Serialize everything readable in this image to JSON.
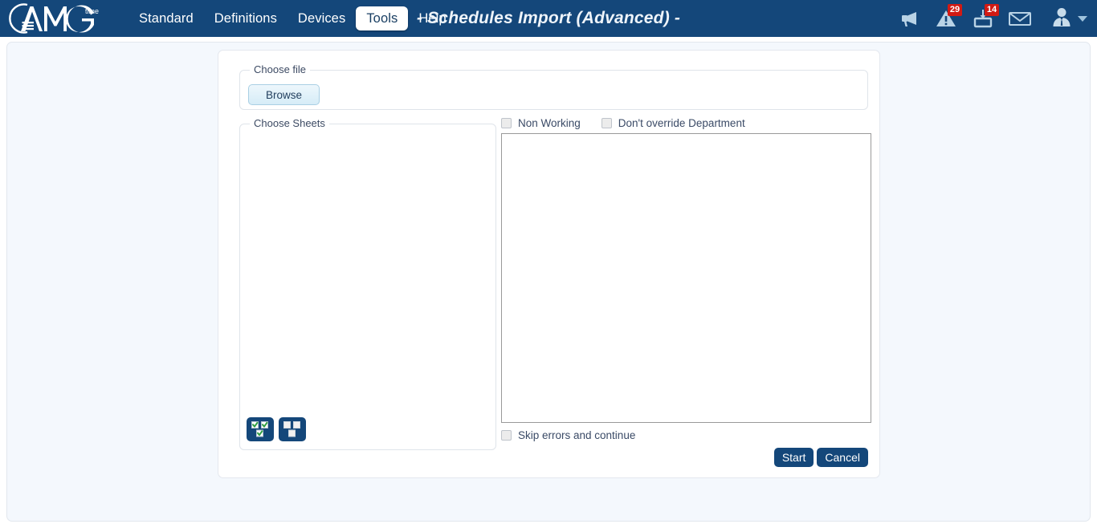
{
  "header": {
    "logo_text": "AMG",
    "logo_superscript": "time",
    "title": "- Schedules Import (Advanced) -",
    "nav": [
      {
        "label": "Standard",
        "active": false,
        "name": "nav-standard"
      },
      {
        "label": "Definitions",
        "active": false,
        "name": "nav-definitions"
      },
      {
        "label": "Devices",
        "active": false,
        "name": "nav-devices"
      },
      {
        "label": "Tools",
        "active": true,
        "name": "nav-tools"
      },
      {
        "label": "Help",
        "active": false,
        "name": "nav-help"
      }
    ],
    "icons": {
      "announcement": "megaphone-icon",
      "alerts": "warning-triangle-icon",
      "alerts_badge": "29",
      "devices": "device-tray-icon",
      "devices_badge": "14",
      "messages": "envelope-icon",
      "user": "user-avatar-icon",
      "user_caret": "chevron-down-icon"
    },
    "colors": {
      "bar_background": "#14477a",
      "badge_background": "#d11a14",
      "active_tab_background": "#ffffff",
      "active_tab_text": "#1a3f63",
      "nav_text": "#ffffff",
      "title_text": "#eef4fa"
    }
  },
  "content": {
    "background": "#f4f8fd",
    "panel_background": "#ffffff"
  },
  "choose_file": {
    "legend": "Choose file",
    "browse_label": "Browse"
  },
  "choose_sheets": {
    "legend": "Choose Sheets",
    "items": [],
    "select_all_title": "Select All",
    "deselect_all_title": "Deselect All"
  },
  "options": {
    "non_working": {
      "label": "Non Working",
      "checked": false
    },
    "dont_override_department": {
      "label": "Don't override Department",
      "checked": false
    },
    "skip_errors": {
      "label": "Skip errors and continue",
      "checked": false
    }
  },
  "log": {
    "value": "",
    "placeholder": ""
  },
  "actions": {
    "start_label": "Start",
    "cancel_label": "Cancel",
    "button_color": "#14477a"
  }
}
